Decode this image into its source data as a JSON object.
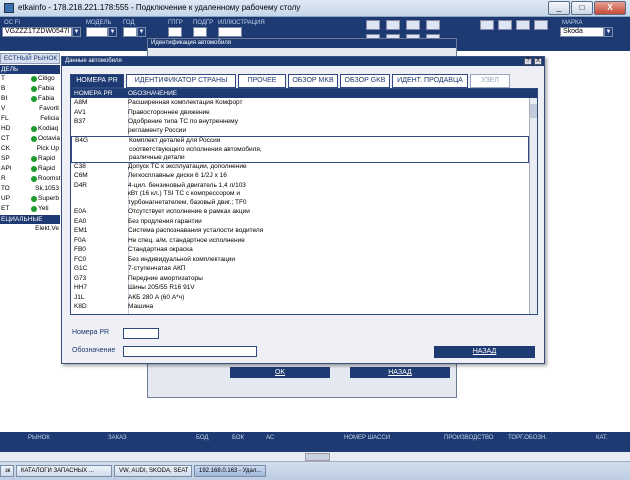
{
  "window": {
    "title": "etkainfo - 178.218.221.178:555 - Подключение к удаленному рабочему столу",
    "min": "_",
    "max": "□",
    "close": "X"
  },
  "topbar": {
    "labels": [
      "ОС FI",
      "МОДЕЛЬ",
      "ГОД",
      "ГПГР",
      "ПОДГР",
      "ИЛЛЮСТРАЦИЯ",
      "МАРКА"
    ],
    "vin": "VGZZZ1TZDW0547I",
    "brand": "Skoda"
  },
  "sidebar": {
    "tab": "ЕСТНЫЙ РЫНОК",
    "header": "ДЕЛЬ",
    "rows": [
      {
        "c": "T",
        "m": "Citigo",
        "dot": true
      },
      {
        "c": "B",
        "m": "Fabia",
        "dot": true
      },
      {
        "c": "BI",
        "m": "Fabia",
        "dot": true
      },
      {
        "c": "V",
        "m": "Favorit",
        "dot": false
      },
      {
        "c": "FL",
        "m": "Felicia",
        "dot": false
      },
      {
        "c": "HD",
        "m": "Kodiaq",
        "dot": true
      },
      {
        "c": "CT",
        "m": "Octavia",
        "dot": true
      },
      {
        "c": "CK",
        "m": "Pick Up",
        "dot": false
      },
      {
        "c": "SP",
        "m": "Rapid",
        "dot": true
      },
      {
        "c": "API",
        "m": "Rapid",
        "dot": true
      },
      {
        "c": "R",
        "m": "Roomst",
        "dot": true
      },
      {
        "c": "ТО",
        "m": "Sk.1053",
        "dot": false
      },
      {
        "c": "UP",
        "m": "Superb",
        "dot": true
      },
      {
        "c": "ET",
        "m": "Yeti",
        "dot": true
      }
    ],
    "special_header": "ЕЦИАЛЬНЫЕ КАТА",
    "special_row": "Elekt.Ve"
  },
  "bg_dialog": {
    "title": "Идентификация автомобиля",
    "ok": "OK",
    "back": "НАЗАД"
  },
  "dialog": {
    "title": "Данные автомобиля",
    "help": "?",
    "close": "X",
    "tabs": [
      {
        "label": "НОМЕРА PR",
        "state": "active"
      },
      {
        "label": "ИДЕНТИФИКАТОР СТРАНЫ",
        "state": "normal"
      },
      {
        "label": "ПРОЧЕЕ",
        "state": "normal"
      },
      {
        "label": "ОБЗОР MKB",
        "state": "normal"
      },
      {
        "label": "ОБЗОР GKB",
        "state": "normal"
      },
      {
        "label": "ИДЕНТ. ПРОДАВЦА",
        "state": "normal"
      },
      {
        "label": "УЗЕЛ",
        "state": "disabled"
      }
    ],
    "table": {
      "col1": "НОМЕРА PR",
      "col2": "ОБОЗНАЧЕНИЕ",
      "rows": [
        {
          "code": "A8M",
          "desc": [
            "Расширенная комплектация Комфорт"
          ]
        },
        {
          "code": "AV1",
          "desc": [
            "Правостороннее движение"
          ]
        },
        {
          "code": "B37",
          "desc": [
            "Одобрение типа ТС по внутреннему",
            "регламенту России"
          ]
        },
        {
          "code": "B4G",
          "desc": [
            "Комплект деталей для России",
            "соответствующего исполнения автомобиля,",
            "различные детали"
          ],
          "selected": true
        },
        {
          "code": "C38",
          "desc": [
            "Допуск ТС к эксплуатации, дополнение"
          ]
        },
        {
          "code": "C6M",
          "desc": [
            "Легкосплавные диски 6 1/2J x 16"
          ]
        },
        {
          "code": "D4R",
          "desc": [
            "4-цил. бензиновый двигатель 1,4 л/103",
            "кВт (16 кл.) TSI ТС с компрессором и",
            "турбонагнетателем, базовый двиг.; TF0"
          ]
        },
        {
          "code": "E0A",
          "desc": [
            "Отсутствует исполнение в рамках акции"
          ]
        },
        {
          "code": "EA0",
          "desc": [
            "Без продления гарантии"
          ]
        },
        {
          "code": "EM1",
          "desc": [
            "Система распознавания усталости водителя"
          ]
        },
        {
          "code": "F0A",
          "desc": [
            "Не спец. а/м, стандартное исполнение"
          ]
        },
        {
          "code": "FB0",
          "desc": [
            "Стандартная окраска"
          ]
        },
        {
          "code": "FC0",
          "desc": [
            "Без индивидуальной комплектации"
          ]
        },
        {
          "code": "G1C",
          "desc": [
            "7-ступенчатая АКП"
          ]
        },
        {
          "code": "G73",
          "desc": [
            "Передние амортизаторы"
          ]
        },
        {
          "code": "HH7",
          "desc": [
            "Шины 205/55 R16 91V"
          ]
        },
        {
          "code": "J1L",
          "desc": [
            "АКБ 280 A (60 А*ч)"
          ]
        },
        {
          "code": "K8D",
          "desc": [
            "Машина"
          ]
        }
      ]
    },
    "pr_label": "Номера PR",
    "desc_label": "Обозначение",
    "back": "НАЗАД"
  },
  "bottombar": [
    "РЫНОК",
    "ЗАКАЗ",
    "БОД",
    "БОК",
    "АС",
    "НОМЕР ШАССИ",
    "ПРОИЗВОДСТВО",
    "ТОРГ.ОБОЗН.",
    "КАТ."
  ],
  "taskbar": [
    {
      "label": "зк",
      "active": false
    },
    {
      "label": "КАТАЛОГИ ЗАПАСНЫХ ...",
      "active": false
    },
    {
      "label": "VW, AUDI, SKODA, SEAT",
      "active": false
    },
    {
      "label": "192.168.0.163 - Удал...",
      "active": true
    }
  ]
}
